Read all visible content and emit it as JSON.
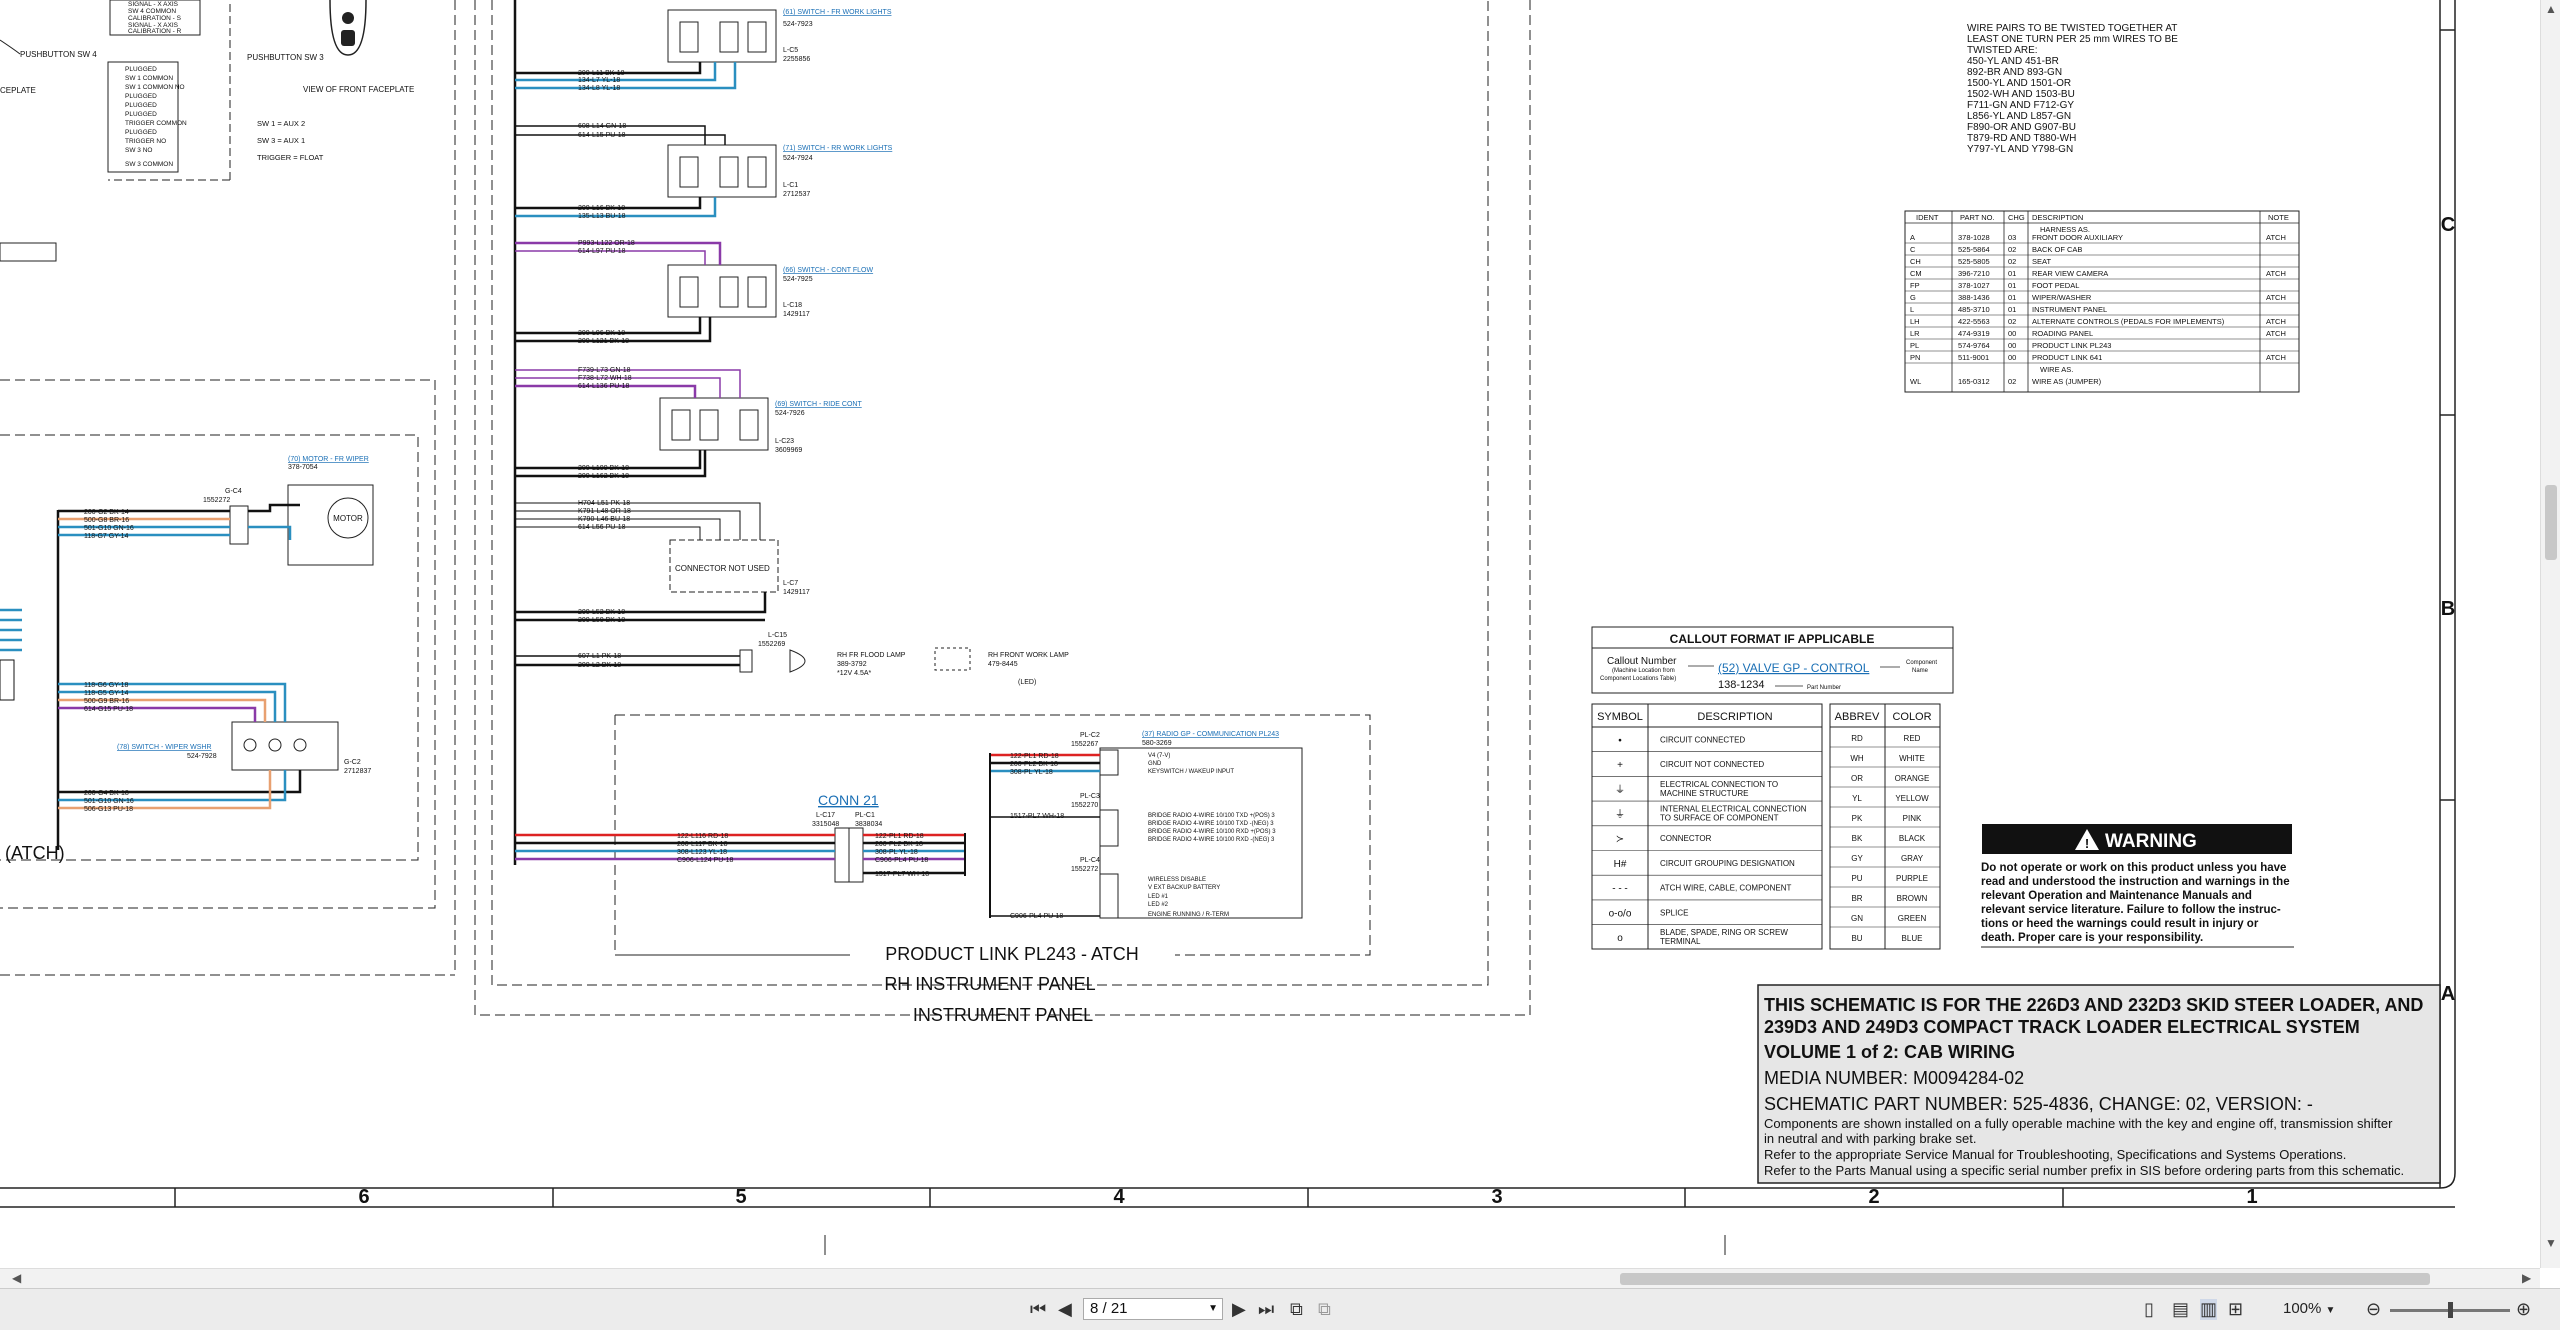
{
  "top_left": {
    "pushbutton_sw4": "PUSHBUTTON SW 4",
    "pushbutton_sw3": "PUSHBUTTON SW 3",
    "faceplate_left": "CEPLATE",
    "faceplate_right": "VIEW OF FRONT FACEPLATE",
    "aux_notes": [
      "SW 1 = AUX 2",
      "SW 3 = AUX 1",
      "TRIGGER = FLOAT"
    ],
    "pin_list_top": [
      "SIGNAL - X AXIS",
      "SW 4 COMMON",
      "CALIBRATION - S",
      "SIGNAL - X AXIS",
      "CALIBRATION - R"
    ],
    "pin_list": [
      "PLUGGED",
      "SW 1 COMMON",
      "SW 1 COMMON NO",
      "PLUGGED",
      "PLUGGED",
      "PLUGGED",
      "TRIGGER COMMON",
      "PLUGGED",
      "TRIGGER NO",
      "SW 3 NO",
      "SW 3 COMMON"
    ]
  },
  "switches": [
    {
      "link": "(61) SWITCH - FR WORK LIGHTS",
      "part": "524-7923",
      "conn": "L-C5",
      "conn_part": "2255856",
      "wires": [
        "200-L11 BK-18",
        "134-L7 YL-18",
        "134-L8 YL-18"
      ]
    },
    {
      "link": "(71) SWITCH - RR WORK LIGHTS",
      "part": "524-7924",
      "conn": "L-C1",
      "conn_part": "2712537",
      "wires_top": [
        "608-L14 GN-18",
        "614-L15 PU-18"
      ],
      "wires": [
        "200-L16 BK-18",
        "135-L13 BU-18"
      ]
    },
    {
      "link": "(66) SWITCH - CONT FLOW",
      "part": "524-7925",
      "conn": "L-C18",
      "conn_part": "1429117",
      "wires_top": [
        "P993-L122 OR-18",
        "614-L97 PU-18"
      ],
      "wires": [
        "200-L96 BK-18",
        "200-L121 BK-18"
      ]
    },
    {
      "link": "(69) SWITCH - RIDE CONT",
      "part": "524-7926",
      "conn": "L-C23",
      "conn_part": "3609969",
      "wires_top": [
        "F739-L73 GN-18",
        "F738-L72 WH-18",
        "614-L136 PU-18"
      ],
      "wires": [
        "200-L109 BK-18",
        "200-L162 BK-18"
      ]
    }
  ],
  "connector_not_used": {
    "label": "CONNECTOR NOT USED",
    "conn": "L-C7",
    "conn_part": "1429117",
    "wires_top": [
      "H704-L51 PK-18",
      "K791-L48 OR-18",
      "K790-L46 BU-18",
      "614-L56 PU-18"
    ],
    "wires": [
      "200-L52 BK-18",
      "200-L50 BK-18"
    ]
  },
  "flood_lamp": {
    "conn": "L-C15",
    "conn_part": "1552269",
    "wires": [
      "607-L1 PK-18",
      "200-L2 BK-18"
    ],
    "lamp": "RH FR FLOOD LAMP",
    "lamp_part": "389-3792",
    "lamp_spec": "*12V 4.5A*",
    "front_lamp": "RH FRONT WORK LAMP",
    "front_part": "479-8445",
    "front_tag": "(LED)"
  },
  "wiper": {
    "motor_link": "(70) MOTOR - FR WIPER",
    "motor_part": "378-7054",
    "motor_label": "MOTOR",
    "motor_conn": "G-C4",
    "motor_conn_part": "1552272",
    "motor_wires": [
      "200-G2 BK-14",
      "500-G8 BR-16",
      "501-G10 GN-16",
      "118-G7 GY-14"
    ],
    "switch_link": "(78) SWITCH - WIPER WSHR",
    "switch_part": "524-7928",
    "switch_conn": "G-C2",
    "switch_conn_part": "2712837",
    "switch_wires_top": [
      "118-G6 GY-18",
      "118-G5 GY-14",
      "500-G9 BR-16",
      "614-G15 PU-18"
    ],
    "switch_wires_bottom": [
      "200-G4 BK-18",
      "501-G10 GN-16",
      "506-G13 PU-18"
    ],
    "atch": "(ATCH)"
  },
  "conn21": {
    "title": "CONN 21",
    "l_conn": "L-C17",
    "l_part": "3315048",
    "pl_conn": "PL-C1",
    "pl_part": "3838034",
    "wires_left": [
      "122-L116 RD-18",
      "200-L117 BK-18",
      "308-L123 YL-18",
      "C906-L124 PU-18"
    ],
    "wires_right": [
      "122-PL1 RD-18",
      "200-PL2 BK-18",
      "308-PL YL-18",
      "C906-PL4 PU-18",
      "1517-PL7 WH-18"
    ]
  },
  "radio": {
    "link": "(37) RADIO GP - COMMUNICATION PL243",
    "part": "580-3269",
    "pl_c2": "PL-C2",
    "pl_c2_part": "1552267",
    "pl_c2_wires": [
      "122-PL1 RD-18",
      "200-PL2 BK-18",
      "308-PL YL-18"
    ],
    "pl_c2_pins": [
      "V4 (7-V)",
      "GND",
      "KEYSWITCH / WAKEUP INPUT"
    ],
    "pl_c3": "PL-C3",
    "pl_c3_part": "1552270",
    "pl_c3_wire": "1517-PL7 WH-18",
    "pl_c3_pins": [
      "BRIDGE RADIO 4-WIRE 10/100 TXD +(POS) 3",
      "BRIDGE RADIO 4-WIRE 10/100 TXD -(NEG) 3",
      "BRIDGE RADIO 4-WIRE 10/100 RXD +(POS) 3",
      "BRIDGE RADIO 4-WIRE 10/100 RXD -(NEG) 3"
    ],
    "pl_c4": "PL-C4",
    "pl_c4_part": "1552272",
    "pl_c4_wire": "C906-PL4 PU-18",
    "pl_c4_pins": [
      "WIRELESS DISABLE",
      "V EXT BACKUP BATTERY",
      "LED #1",
      "LED #2",
      "ENGINE RUNNING / R-TERM"
    ]
  },
  "panels": {
    "product_link": "PRODUCT LINK PL243 - ATCH",
    "rh_panel": "RH INSTRUMENT PANEL",
    "panel": "INSTRUMENT PANEL"
  },
  "twist_note": {
    "heading": [
      "WIRE PAIRS TO BE TWISTED TOGETHER AT",
      "LEAST ONE TURN PER 25 mm WIRES TO BE",
      "TWISTED ARE:"
    ],
    "pairs": [
      "450-YL AND 451-BR",
      "892-BR AND 893-GN",
      "1500-YL AND 1501-OR",
      "1502-WH AND 1503-BU",
      "F711-GN AND F712-GY",
      "L856-YL AND L857-GN",
      "F890-OR AND G907-BU",
      "T879-RD AND T880-WH",
      "Y797-YL AND Y798-GN"
    ]
  },
  "harness_table": {
    "headers": [
      "IDENT",
      "PART NO.",
      "CHG",
      "DESCRIPTION",
      "NOTE"
    ],
    "group1": "HARNESS AS.",
    "rows": [
      [
        "A",
        "378-1028",
        "03",
        "FRONT DOOR AUXILIARY",
        "ATCH"
      ],
      [
        "C",
        "525-5864",
        "02",
        "BACK OF CAB",
        ""
      ],
      [
        "CH",
        "525-5805",
        "02",
        "SEAT",
        ""
      ],
      [
        "CM",
        "396-7210",
        "01",
        "REAR VIEW CAMERA",
        "ATCH"
      ],
      [
        "FP",
        "378-1027",
        "01",
        "FOOT PEDAL",
        ""
      ],
      [
        "G",
        "388-1436",
        "01",
        "WIPER/WASHER",
        "ATCH"
      ],
      [
        "L",
        "485-3710",
        "01",
        "INSTRUMENT PANEL",
        ""
      ],
      [
        "LH",
        "422-5563",
        "02",
        "ALTERNATE CONTROLS (PEDALS FOR IMPLEMENTS)",
        "ATCH"
      ],
      [
        "LR",
        "474-9319",
        "00",
        "ROADING PANEL",
        "ATCH"
      ],
      [
        "PL",
        "574-9764",
        "00",
        "PRODUCT LINK PL243",
        ""
      ],
      [
        "PN",
        "511-9001",
        "00",
        "PRODUCT LINK 641",
        "ATCH"
      ]
    ],
    "group2": "WIRE AS.",
    "rows2": [
      [
        "WL",
        "165-0312",
        "02",
        "WIRE AS (JUMPER)",
        ""
      ]
    ]
  },
  "callout": {
    "title": "CALLOUT FORMAT IF APPLICABLE",
    "callout_number": "Callout Number",
    "callout_note": [
      "(Machine Location from",
      "Component Locations Table)"
    ],
    "example": "(52) VALVE GP - CONTROL",
    "component_name": [
      "Component",
      "Name"
    ],
    "part_example": "138-1234",
    "part_number": "Part Number"
  },
  "symbols": {
    "headers": [
      "SYMBOL",
      "DESCRIPTION"
    ],
    "rows": [
      {
        "sym": "•",
        "desc": [
          "CIRCUIT CONNECTED"
        ]
      },
      {
        "sym": "+",
        "desc": [
          "CIRCUIT NOT CONNECTED"
        ]
      },
      {
        "sym": "⏚",
        "desc": [
          "ELECTRICAL CONNECTION TO",
          "MACHINE STRUCTURE"
        ]
      },
      {
        "sym": "⏚",
        "desc": [
          "INTERNAL ELECTRICAL CONNECTION",
          "TO SURFACE OF COMPONENT"
        ]
      },
      {
        "sym": "≻",
        "desc": [
          "CONNECTOR"
        ]
      },
      {
        "sym": "H#",
        "desc": [
          "CIRCUIT GROUPING DESIGNATION"
        ]
      },
      {
        "sym": "- - -",
        "desc": [
          "ATCH WIRE, CABLE, COMPONENT"
        ]
      },
      {
        "sym": "o-o/o",
        "desc": [
          "SPLICE"
        ]
      },
      {
        "sym": "o",
        "desc": [
          "BLADE, SPADE, RING OR SCREW",
          "TERMINAL"
        ]
      }
    ]
  },
  "colors": {
    "headers": [
      "ABBREV",
      "COLOR"
    ],
    "rows": [
      [
        "RD",
        "RED"
      ],
      [
        "WH",
        "WHITE"
      ],
      [
        "OR",
        "ORANGE"
      ],
      [
        "YL",
        "YELLOW"
      ],
      [
        "PK",
        "PINK"
      ],
      [
        "BK",
        "BLACK"
      ],
      [
        "GY",
        "GRAY"
      ],
      [
        "PU",
        "PURPLE"
      ],
      [
        "BR",
        "BROWN"
      ],
      [
        "GN",
        "GREEN"
      ],
      [
        "BU",
        "BLUE"
      ]
    ]
  },
  "warning": {
    "title": "WARNING",
    "lines": [
      "Do not operate or work on this product unless you have",
      "read and understood the instruction and warnings in the",
      "relevant Operation and Maintenance Manuals and",
      "relevant service literature. Failure to follow the instruc-",
      "tions or heed the warnings could result in injury or",
      "death. Proper care is your responsibility."
    ]
  },
  "title_block": {
    "line1": "THIS SCHEMATIC IS FOR THE 226D3 AND 232D3 SKID STEER LOADER, AND",
    "line2": "239D3 AND 249D3 COMPACT TRACK LOADER ELECTRICAL SYSTEM",
    "line3": "VOLUME 1 of 2: CAB WIRING",
    "media": "MEDIA NUMBER: M0094284-02",
    "part": "SCHEMATIC PART NUMBER: 525-4836, CHANGE: 02, VERSION: -",
    "notes": [
      "Components are shown installed on a fully operable machine with the key and engine off, transmission shifter",
      "in neutral and with parking brake set.",
      "Refer to the appropriate Service Manual for Troubleshooting, Specifications and Systems Operations.",
      "Refer to the Parts Manual using a specific serial number prefix in SIS before ordering parts from this schematic."
    ]
  },
  "grid": {
    "columns": [
      "6",
      "5",
      "4",
      "3",
      "2",
      "1"
    ],
    "rows": [
      "C",
      "B",
      "A"
    ]
  },
  "viewer": {
    "page": "8 / 21",
    "zoom": "100%",
    "colors": {
      "toolbar": "#ececec",
      "wire_blue": "#2a8fc0",
      "wire_purple": "#8a3aa8",
      "wire_red": "#d22",
      "wire_orange": "#e8a070",
      "link": "#1a6fb5"
    }
  }
}
